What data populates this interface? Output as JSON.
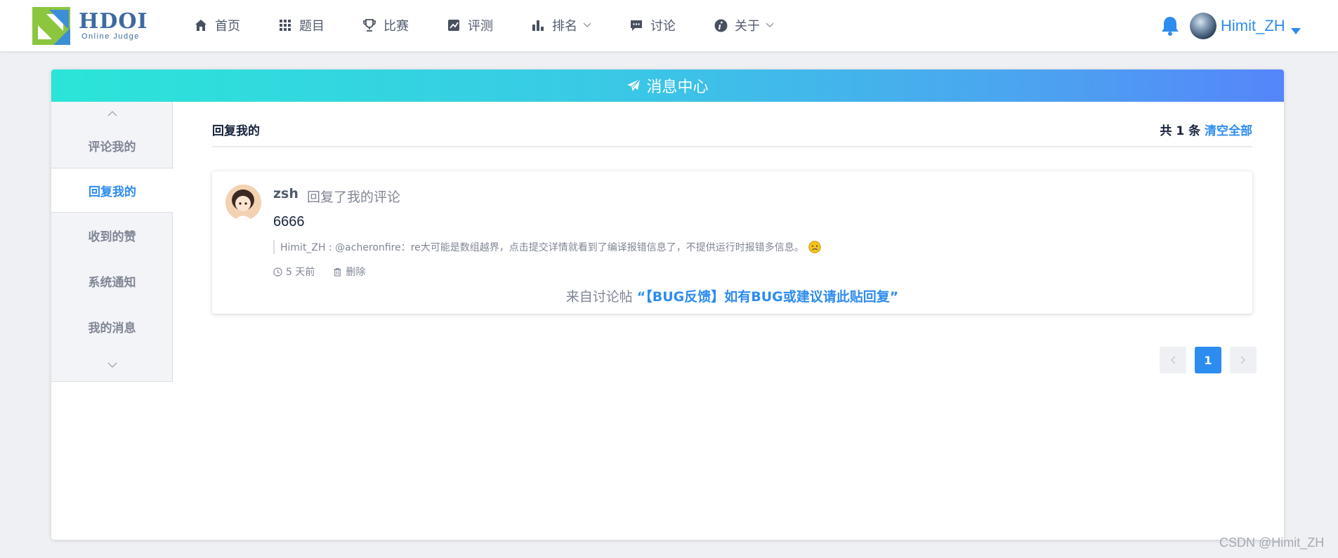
{
  "brand": {
    "name": "HDOI",
    "tagline": "Online Judge"
  },
  "nav": [
    {
      "label": "首页",
      "icon": "home-icon"
    },
    {
      "label": "题目",
      "icon": "grid-icon"
    },
    {
      "label": "比赛",
      "icon": "trophy-icon"
    },
    {
      "label": "评测",
      "icon": "chart-line-icon"
    },
    {
      "label": "排名",
      "icon": "bar-chart-icon",
      "dropdown": true
    },
    {
      "label": "讨论",
      "icon": "comment-icon"
    },
    {
      "label": "关于",
      "icon": "info-icon",
      "dropdown": true
    }
  ],
  "user": {
    "name": "Himit_ZH"
  },
  "panel": {
    "title": "消息中心"
  },
  "sidebar": {
    "items": [
      {
        "label": "评论我的"
      },
      {
        "label": "回复我的",
        "active": true
      },
      {
        "label": "收到的赞"
      },
      {
        "label": "系统通知"
      },
      {
        "label": "我的消息"
      }
    ]
  },
  "content": {
    "title": "回复我的",
    "count_prefix": "共",
    "count": "1",
    "count_suffix": "条",
    "clear_all": "清空全部"
  },
  "message": {
    "sender": "zsh",
    "action": "回复了我的评论",
    "reply": "6666",
    "quote": "Himit_ZH : @acheronfire：re大可能是数组越界，点击提交详情就看到了编译报错信息了，不提供运行时报错多信息。",
    "time": "5 天前",
    "delete_label": "删除",
    "source_prefix": "来自讨论帖",
    "source_title": "“【BUG反馈】如有BUG或建议请此贴回复”"
  },
  "pagination": {
    "current": "1"
  },
  "watermark": "CSDN @Himit_ZH",
  "colors": {
    "accent": "#2d8cf0",
    "header_gradient_start": "#2be5d8",
    "header_gradient_end": "#5585fb",
    "logo_green": "#8cc63f",
    "logo_blue": "#3c6aa1"
  }
}
